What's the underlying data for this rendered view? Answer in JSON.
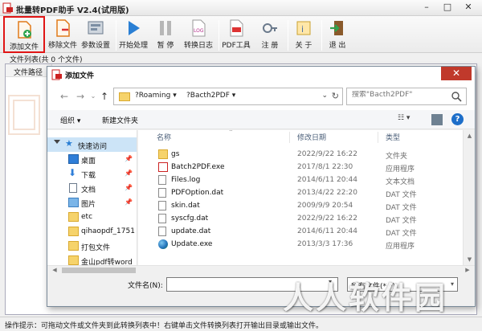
{
  "app": {
    "title": "批量转PDF助手 V2.4(试用版)",
    "window_controls": [
      "–",
      "□",
      "✕"
    ]
  },
  "toolbar": {
    "items": [
      {
        "label": "添加文件",
        "icon": "add-file-icon"
      },
      {
        "label": "移除文件",
        "icon": "remove-file-icon"
      },
      {
        "label": "参数设置",
        "icon": "settings-icon"
      },
      {
        "label": "开始处理",
        "icon": "play-icon"
      },
      {
        "label": "暂 停",
        "icon": "pause-icon"
      },
      {
        "label": "转换日志",
        "icon": "log-icon"
      },
      {
        "label": "PDF工具",
        "icon": "pdf-tools-icon"
      },
      {
        "label": "注 册",
        "icon": "register-icon"
      },
      {
        "label": "关 于",
        "icon": "about-icon"
      },
      {
        "label": "退 出",
        "icon": "exit-icon"
      }
    ]
  },
  "file_list": {
    "label": "文件列表(共 0 个文件)",
    "column_header": "文件路径"
  },
  "status": {
    "text": "操作提示：可拖动文件或文件夹到此转换列表中！右键单击文件转换列表打开输出目录或输出文件。"
  },
  "watermark": "人人软件园",
  "dialog": {
    "title": "添加文件",
    "close": "✕",
    "address": {
      "crumbs": [
        "?Roaming ▾",
        "?Bacth2PDF ▾"
      ],
      "dropdown": "⌄",
      "refresh": "↻"
    },
    "search": {
      "placeholder": "搜索\"Bacth2PDF\""
    },
    "commands": {
      "organize": "组织 ▾",
      "new_folder": "新建文件夹",
      "view": "☷ ▾"
    },
    "help": "?",
    "nav_items": [
      {
        "label": "快速访问",
        "icon": "star-icon",
        "pinned": false
      },
      {
        "label": "桌面",
        "icon": "desktop-icon",
        "pinned": true
      },
      {
        "label": "下载",
        "icon": "download-icon",
        "pinned": true
      },
      {
        "label": "文档",
        "icon": "document-icon",
        "pinned": true
      },
      {
        "label": "图片",
        "icon": "picture-icon",
        "pinned": true
      },
      {
        "label": "etc",
        "icon": "folder-icon",
        "pinned": false
      },
      {
        "label": "qihaopdf_1751",
        "icon": "folder-icon",
        "pinned": false
      },
      {
        "label": "打包文件",
        "icon": "folder-icon",
        "pinned": false
      },
      {
        "label": "金山pdf转word",
        "icon": "folder-icon",
        "pinned": false
      }
    ],
    "columns": {
      "name": "名称",
      "date": "修改日期",
      "type": "类型"
    },
    "files": [
      {
        "name": "gs",
        "date": "2022/9/22 16:22",
        "type": "文件夹",
        "icon": "folder-icon"
      },
      {
        "name": "Batch2PDF.exe",
        "date": "2017/8/1 22:30",
        "type": "应用程序",
        "icon": "exe-icon"
      },
      {
        "name": "Files.log",
        "date": "2014/6/11 20:44",
        "type": "文本文档",
        "icon": "file-icon"
      },
      {
        "name": "PDFOption.dat",
        "date": "2013/4/22 22:20",
        "type": "DAT 文件",
        "icon": "file-icon"
      },
      {
        "name": "skin.dat",
        "date": "2009/9/9 20:54",
        "type": "DAT 文件",
        "icon": "file-icon"
      },
      {
        "name": "syscfg.dat",
        "date": "2022/9/22 16:22",
        "type": "DAT 文件",
        "icon": "file-icon"
      },
      {
        "name": "update.dat",
        "date": "2014/6/11 20:44",
        "type": "DAT 文件",
        "icon": "file-icon"
      },
      {
        "name": "Update.exe",
        "date": "2013/3/3 17:36",
        "type": "应用程序",
        "icon": "globe-icon"
      }
    ],
    "filename_label": "文件名(N):",
    "filename_value": "",
    "filetype_value": "所有文件(*.*)"
  },
  "colors": {
    "selection_outline": "#e01515",
    "nav_highlight": "#cce4f7",
    "close_button": "#c0392b"
  }
}
